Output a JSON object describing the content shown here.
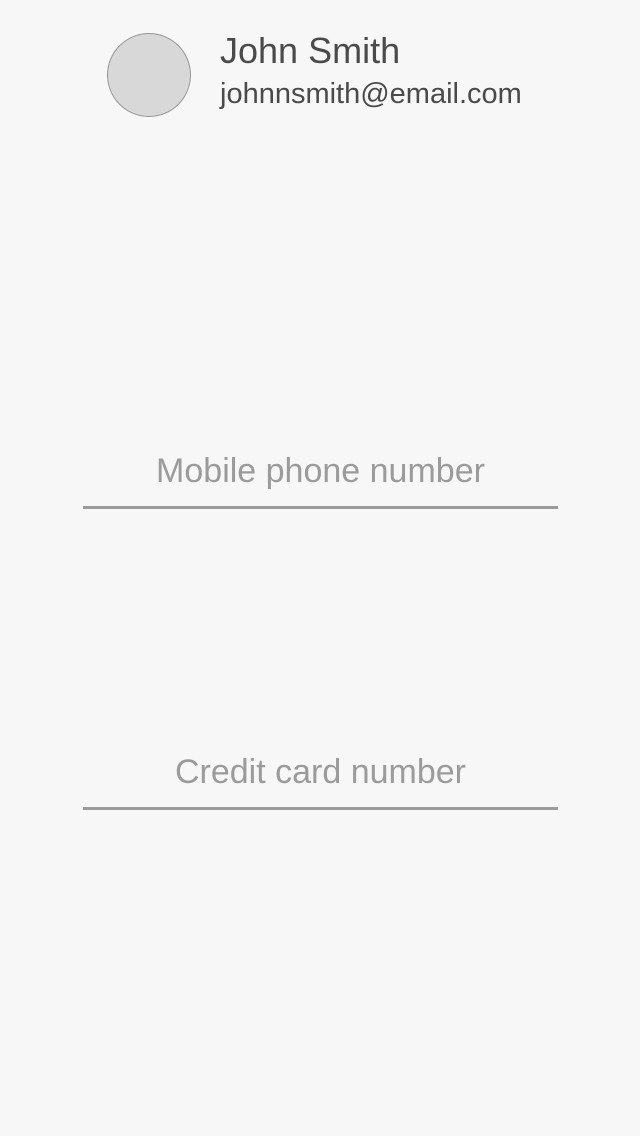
{
  "profile": {
    "name": "John Smith",
    "email": "johnnsmith@email.com",
    "avatar_icon": "avatar-placeholder-icon"
  },
  "form": {
    "phone": {
      "placeholder": "Mobile phone number",
      "value": ""
    },
    "credit_card": {
      "placeholder": "Credit card number",
      "value": ""
    }
  },
  "colors": {
    "background": "#f7f7f7",
    "avatar_fill": "#d8d8d8",
    "text": "#4a4a4a",
    "placeholder": "#9b9b9b",
    "underline": "#9b9b9b"
  }
}
